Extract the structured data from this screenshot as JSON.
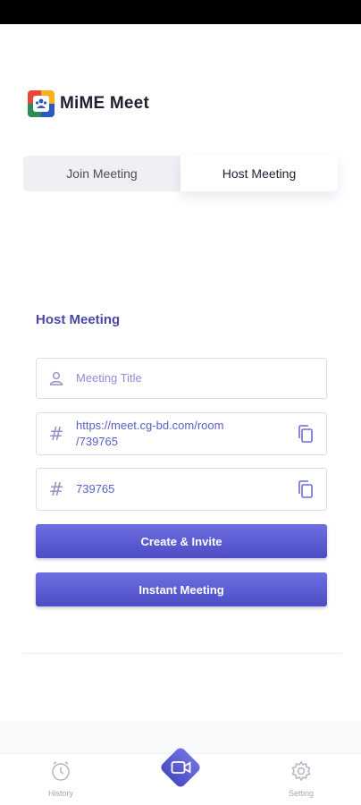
{
  "app": {
    "name": "MiME Meet"
  },
  "tabs": [
    {
      "label": "Join Meeting",
      "active": false
    },
    {
      "label": "Host Meeting",
      "active": true
    }
  ],
  "form": {
    "section_title": "Host Meeting",
    "title_placeholder": "Meeting Title",
    "room_link": "https://meet.cg-bd.com/room\n/739765",
    "room_id": "739765",
    "create_button": "Create & Invite",
    "instant_button": "Instant Meeting"
  },
  "bottom_nav": {
    "history_label": "History",
    "setting_label": "Setting"
  },
  "colors": {
    "accent": "#5556d0",
    "accent_text": "#5b5ec9",
    "title": "#4b48a8"
  },
  "icons": {
    "title_field": "user-icon",
    "link_field": "hash-icon",
    "copy": "copy-icon",
    "history": "clock-icon",
    "setting": "gear-icon",
    "fab": "video-camera-icon"
  }
}
